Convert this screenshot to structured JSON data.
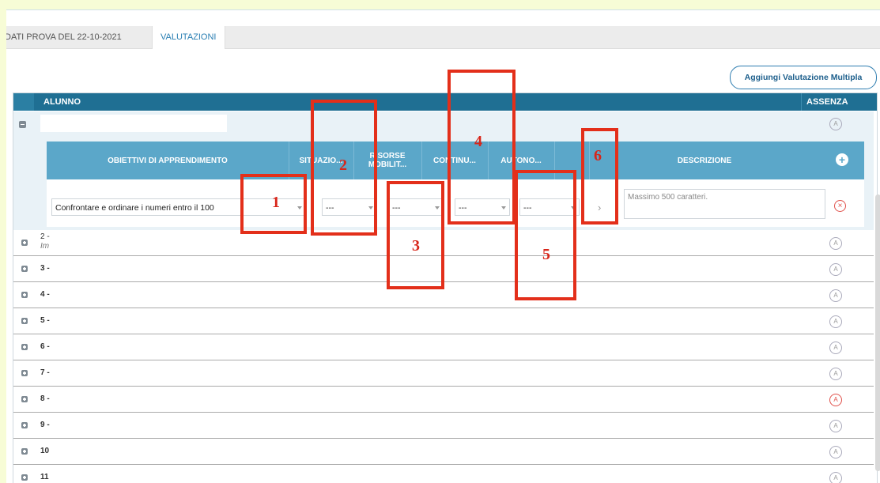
{
  "tabs": [
    {
      "label": "DATI PROVA DEL 22-10-2021"
    },
    {
      "label": "VALUTAZIONI"
    }
  ],
  "multi_button": "Aggiungi Valutazione Multipla",
  "table": {
    "col_alunno": "ALUNNO",
    "col_assenza": "ASSENZA",
    "absent_symbol": "A"
  },
  "detail": {
    "headers": {
      "obiettivi": "OBIETTIVI DI APPRENDIMENTO",
      "situazione": "SITUAZIO...",
      "risorse": "RISORSE MOBILIT...",
      "continuita": "CONTINU...",
      "autonomia": "AUTONO...",
      "descrizione": "DESCRIZIONE"
    },
    "objective_value": "Confrontare e ordinare i numeri entro il 100",
    "select_placeholder": "---",
    "description_placeholder": "Massimo 500 caratteri."
  },
  "rows": [
    {
      "label": "2 -",
      "sub": "Im"
    },
    {
      "label": "3 -"
    },
    {
      "label": "4 -"
    },
    {
      "label": "5 -"
    },
    {
      "label": "6 -"
    },
    {
      "label": "7 -"
    },
    {
      "label": "8 -"
    },
    {
      "label": "9 -"
    },
    {
      "label": "10"
    },
    {
      "label": "11"
    }
  ],
  "annotations": [
    "1",
    "2",
    "3",
    "4",
    "5",
    "6"
  ],
  "colors": {
    "background": "#f7fcd6",
    "header": "#1f6f93",
    "subheader": "#5ba7c9",
    "annotation": "#e32f1a",
    "absent_highlight": "#e0504a"
  }
}
